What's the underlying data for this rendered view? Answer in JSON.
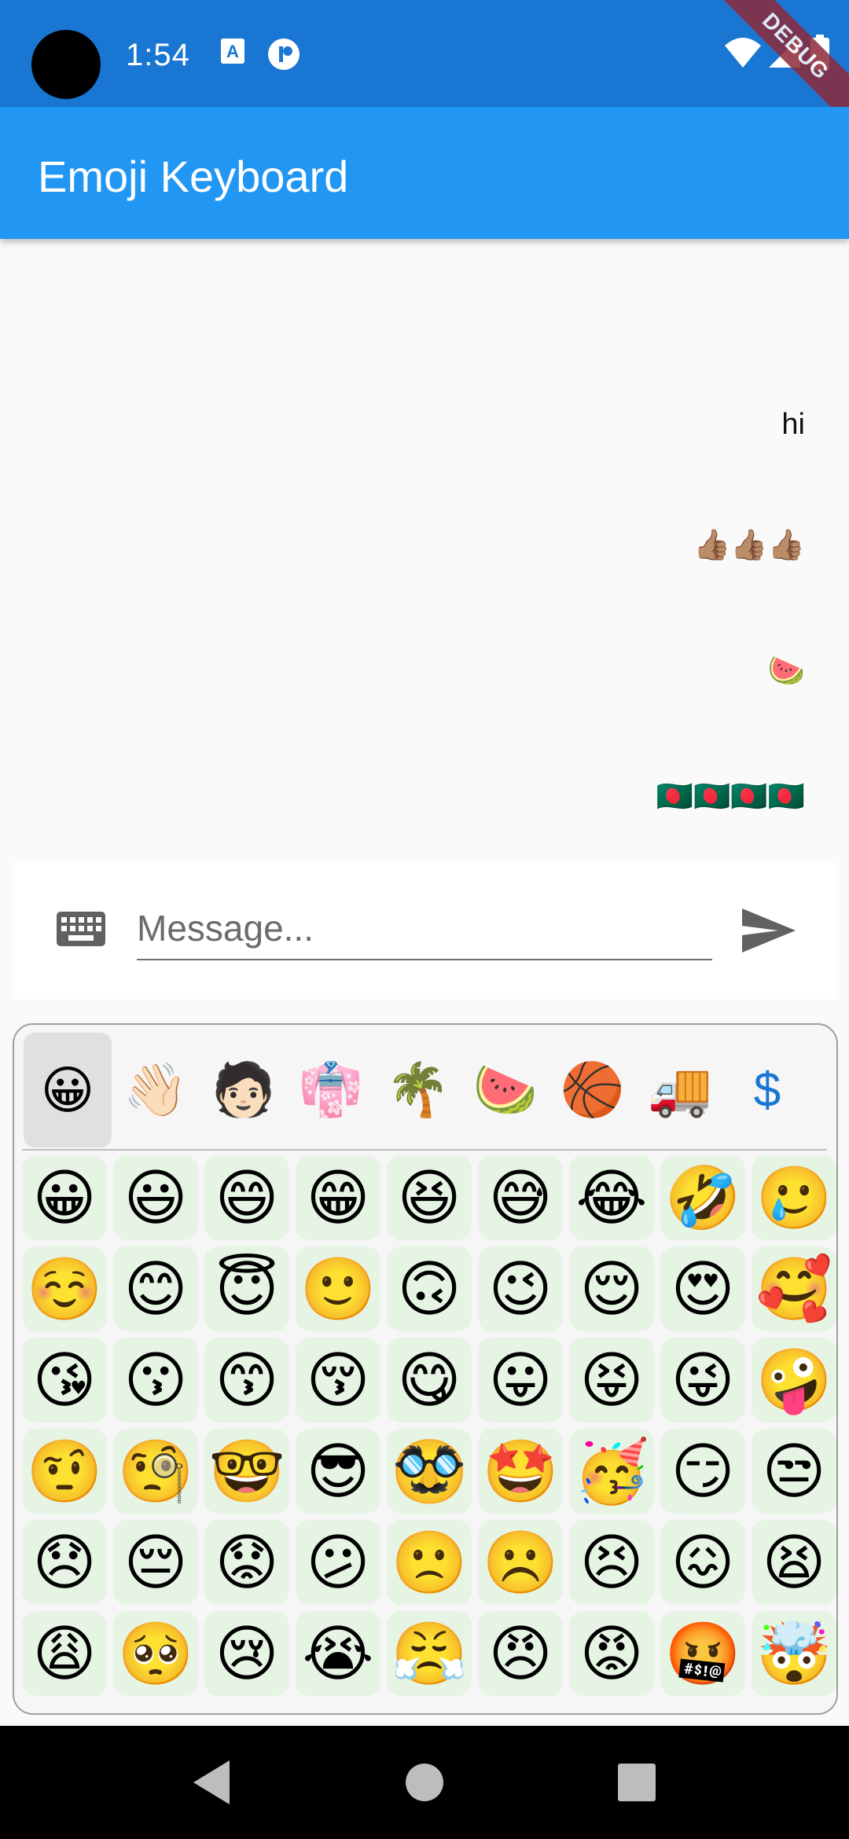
{
  "status_bar": {
    "time": "1:54",
    "debug_label": "DEBUG",
    "icons": [
      "camera-cutout",
      "text-a-icon",
      "record-icon",
      "wifi-icon",
      "signal-icon",
      "battery-icon"
    ]
  },
  "app_bar": {
    "title": "Emoji Keyboard"
  },
  "messages": [
    {
      "text": "hi"
    },
    {
      "text": "👍🏽👍🏽👍🏽"
    },
    {
      "text": "🍉"
    },
    {
      "text": "🇧🇩🇧🇩🇧🇩🇧🇩"
    }
  ],
  "composer": {
    "placeholder": "Message...",
    "value": "",
    "keyboard_icon": "keyboard-icon",
    "send_icon": "send-icon"
  },
  "emoji_categories": [
    {
      "name": "smileys",
      "glyph": "😀",
      "active": true
    },
    {
      "name": "people",
      "glyph": "👋🏻"
    },
    {
      "name": "person",
      "glyph": "🧑🏻"
    },
    {
      "name": "clothing",
      "glyph": "👘"
    },
    {
      "name": "nature",
      "glyph": "🌴"
    },
    {
      "name": "food",
      "glyph": "🍉"
    },
    {
      "name": "activity",
      "glyph": "🏀"
    },
    {
      "name": "travel",
      "glyph": "🚚"
    },
    {
      "name": "symbols",
      "glyph": "$"
    }
  ],
  "emoji_rows": [
    [
      "😀",
      "😃",
      "😄",
      "😁",
      "😆",
      "😅",
      "😂",
      "🤣",
      "🥲"
    ],
    [
      "☺️",
      "😊",
      "😇",
      "🙂",
      "🙃",
      "😉",
      "😌",
      "😍",
      "🥰"
    ],
    [
      "😘",
      "😗",
      "😙",
      "😚",
      "😋",
      "😛",
      "😝",
      "😜",
      "🤪"
    ],
    [
      "🤨",
      "🧐",
      "🤓",
      "😎",
      "🥸",
      "🤩",
      "🥳",
      "😏",
      "😒"
    ],
    [
      "😞",
      "😔",
      "😟",
      "😕",
      "🙁",
      "☹️",
      "😣",
      "😖",
      "😫"
    ],
    [
      "😩",
      "🥺",
      "😢",
      "😭",
      "😤",
      "😠",
      "😡",
      "🤬",
      "🤯"
    ]
  ],
  "colors": {
    "status_bar": "#1976d2",
    "app_bar": "#2196f3",
    "emoji_cell": "#e6f4e4",
    "active_category": "#e0e0e0",
    "navbar": "#000000"
  }
}
